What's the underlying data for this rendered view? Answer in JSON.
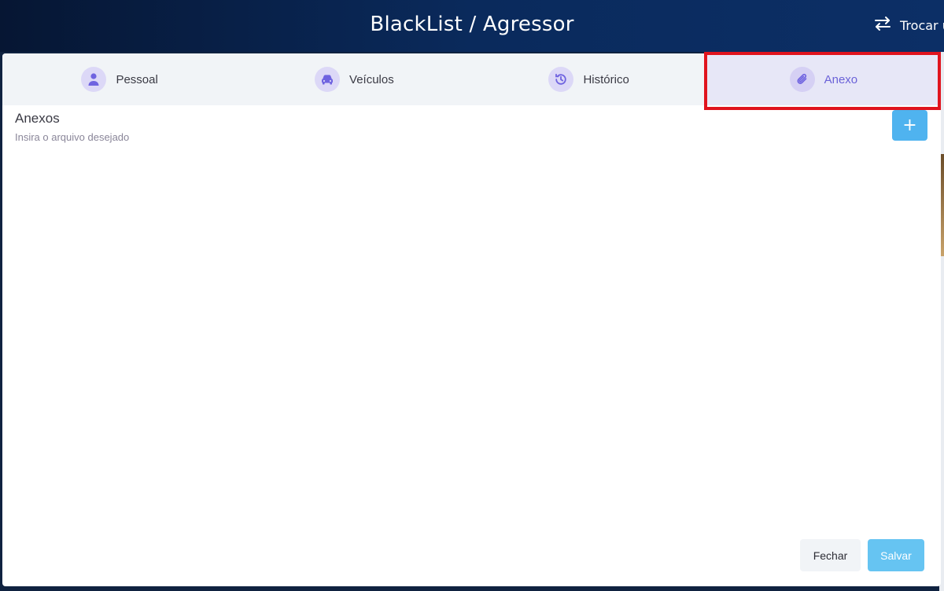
{
  "header": {
    "title": "BlackList / Agressor",
    "swap_label": "Trocar u",
    "swap_icon": "swap-arrows-icon"
  },
  "tabs": [
    {
      "label": "Pessoal",
      "icon": "person-icon",
      "active": false
    },
    {
      "label": "Veículos",
      "icon": "car-icon",
      "active": false
    },
    {
      "label": "Histórico",
      "icon": "history-icon",
      "active": false
    },
    {
      "label": "Anexo",
      "icon": "paperclip-icon",
      "active": true
    }
  ],
  "section": {
    "title": "Anexos",
    "subtitle": "Insira o arquivo desejado",
    "add_label": "+"
  },
  "footer": {
    "close_label": "Fechar",
    "save_label": "Salvar"
  },
  "colors": {
    "accent": "#6b62d8",
    "primary_button": "#4fb3ef",
    "highlight": "#e0141e",
    "header_bg": "#0a2a5c"
  }
}
